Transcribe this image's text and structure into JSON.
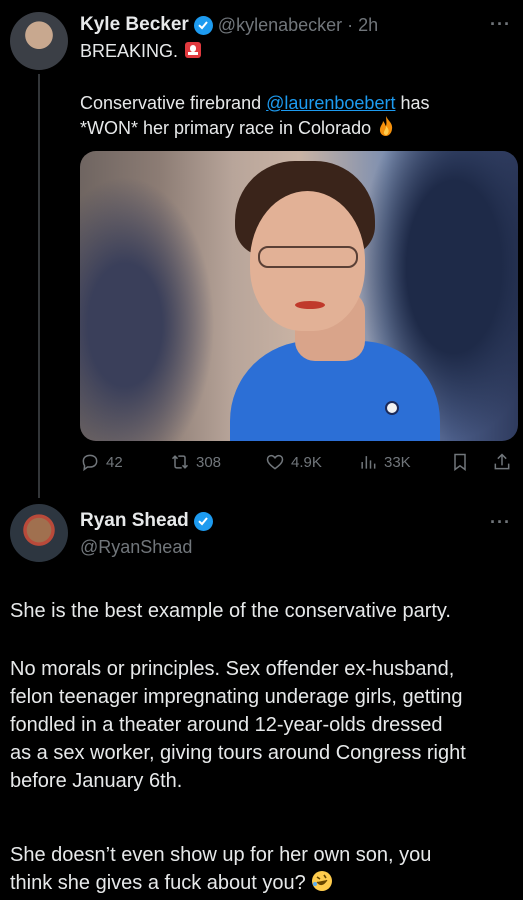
{
  "tweet1": {
    "display_name": "Kyle Becker",
    "handle": "@kylenabecker",
    "separator": "·",
    "time": "2h",
    "more": "···",
    "line1": "BREAKING.",
    "body_part1": "Conservative firebrand ",
    "mention": "@laurenboebert",
    "body_part2": " has",
    "body_line2": "*WON* her primary race in Colorado",
    "actions": {
      "replies": "42",
      "retweets": "308",
      "likes": "4.9K",
      "views": "33K"
    }
  },
  "tweet2": {
    "display_name": "Ryan Shead",
    "handle": "@RyanShead",
    "more": "···",
    "paragraph1": "She is the best example of the conservative party.",
    "paragraph2_lines": [
      "No morals or principles. Sex offender ex-husband,",
      "felon teenager impregnating underage girls, getting",
      "fondled in a theater around 12-year-olds dressed",
      "as a sex worker, giving tours around Congress right",
      "before January 6th."
    ],
    "paragraph3_lines": [
      "She doesn’t even show up for her own son, you",
      "think she gives a fuck about you?"
    ]
  },
  "colors": {
    "background": "#000000",
    "text": "#e7e9ea",
    "secondary": "#71767b",
    "accent": "#1d9bf0"
  },
  "icons": [
    "verified-badge-icon",
    "siren-emoji-icon",
    "fire-emoji-icon",
    "reply-icon",
    "retweet-icon",
    "like-icon",
    "views-icon",
    "bookmark-icon",
    "share-icon",
    "rofl-emoji-icon"
  ]
}
